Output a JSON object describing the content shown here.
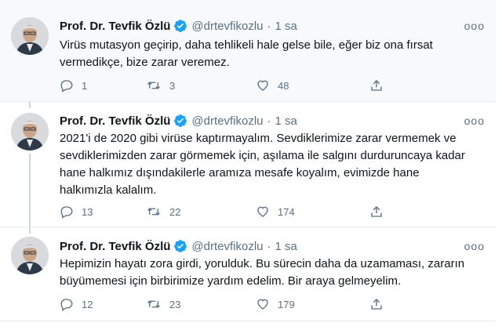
{
  "author": {
    "name": "Prof. Dr. Tevfik Özlü",
    "handle": "@drtevfikozlu",
    "separator": "·"
  },
  "colors": {
    "verified": "#1da1f2",
    "muted": "#5b7083",
    "text": "#0f1419",
    "highlight_bg": "#f7f9fa"
  },
  "icons": {
    "verified": "verified-badge-icon",
    "reply": "reply-icon",
    "retweet": "retweet-icon",
    "like": "heart-icon",
    "share": "share-icon",
    "more": "more-icon"
  },
  "tweets": [
    {
      "time": "1 sa",
      "more": "ooo",
      "text_lines": [
        "Virüs mutasyon geçirip, daha tehlikeli hale gelse bile, eğer biz ona fırsat",
        "vermedikçe, bize zarar veremez."
      ],
      "replies": "1",
      "retweets": "3",
      "likes": "48"
    },
    {
      "time": "1 sa",
      "more": "ooo",
      "text_lines": [
        "2021'i de 2020 gibi virüse kaptırmayalım. Sevdiklerimize zarar vermemek ve",
        "sevdiklerimizden zarar görmemek için, aşılama ile salgını durduruncaya kadar",
        "hane halkımız dışındakilerle aramıza mesafe koyalım, evimizde hane",
        "halkımızla kalalım."
      ],
      "replies": "13",
      "retweets": "22",
      "likes": "174"
    },
    {
      "time": "1 sa",
      "more": "ooo",
      "text_lines": [
        "Hepimizin hayatı zora girdi, yorulduk. Bu sürecin daha da uzamaması, zararın",
        "büyümemesi için birbirimize yardım edelim. Bir araya gelmeyelim."
      ],
      "replies": "12",
      "retweets": "23",
      "likes": "179"
    }
  ]
}
